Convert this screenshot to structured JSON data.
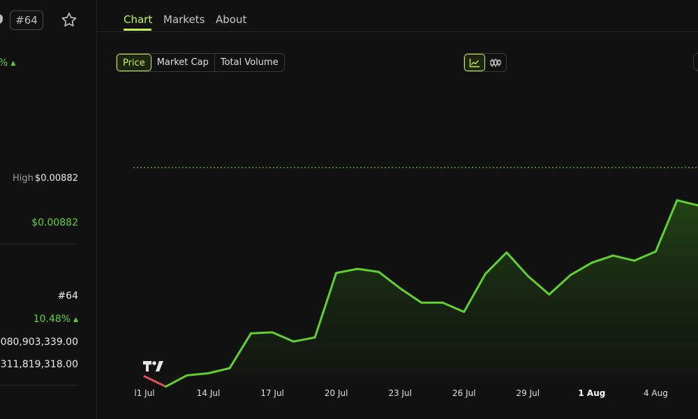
{
  "coin": {
    "rank_badge": "#64",
    "change_top": "%"
  },
  "stats": {
    "high_label": "High",
    "high_value": "$0.00882",
    "price_value": "$0.00882",
    "rank": "#64",
    "change_pct": "10.48%",
    "value_1": ",080,903,339.00",
    "value_2": ",311,819,318.00"
  },
  "tabs": [
    {
      "label": "Chart",
      "active": true
    },
    {
      "label": "Markets",
      "active": false
    },
    {
      "label": "About",
      "active": false
    }
  ],
  "chart_controls": {
    "metric_options": [
      "Price",
      "Market Cap",
      "Total Volume"
    ],
    "selected_metric": "Price",
    "view_modes": [
      "line-chart-icon",
      "candlestick-icon"
    ],
    "selected_view": "line-chart-icon"
  },
  "colors": {
    "accent": "#c6f24b",
    "up": "#5fd22e",
    "down": "#e05252",
    "background": "#111111"
  },
  "chart_data": {
    "type": "line",
    "title": "",
    "xlabel": "",
    "ylabel": "",
    "x_tick_labels": [
      "l1 Jul",
      "14 Jul",
      "17 Jul",
      "20 Jul",
      "23 Jul",
      "26 Jul",
      "29 Jul",
      "1 Aug",
      "4 Aug"
    ],
    "x_tick_bold": "1 Aug",
    "x_days": [
      11,
      12,
      13,
      14,
      15,
      16,
      17,
      18,
      19,
      20,
      21,
      22,
      23,
      24,
      25,
      26,
      27,
      28,
      29,
      30,
      31,
      32,
      33,
      34,
      35,
      36,
      37
    ],
    "y": [
      13.6,
      12.6,
      13.7,
      13.9,
      14.4,
      17.8,
      17.9,
      17.0,
      17.4,
      23.7,
      24.1,
      23.8,
      22.2,
      20.8,
      20.8,
      19.9,
      23.6,
      25.7,
      23.4,
      21.6,
      23.5,
      24.7,
      25.4,
      24.9,
      25.8,
      30.8,
      30.3
    ],
    "baseline": 13.6,
    "reference_line": 34.0,
    "y_range": [
      11.0,
      40.0
    ],
    "area_fill": true,
    "grid": false,
    "watermark": "TV"
  }
}
